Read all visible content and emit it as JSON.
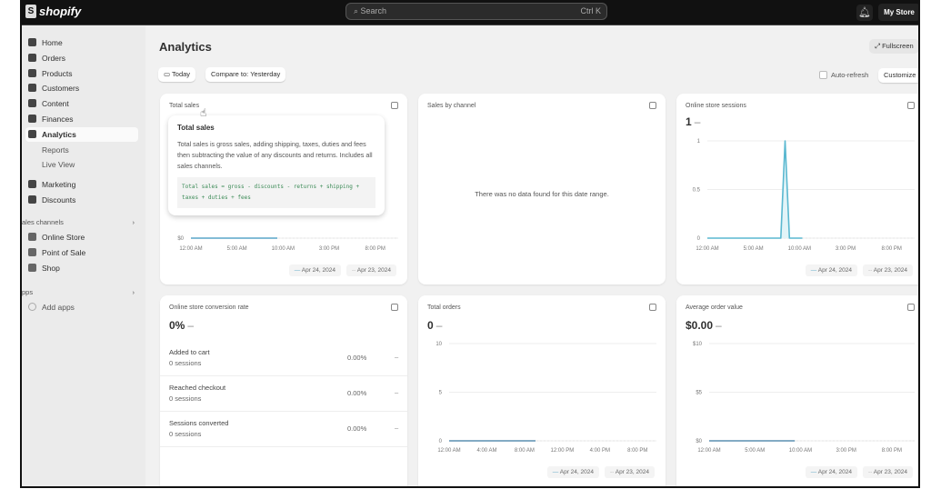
{
  "topbar": {
    "brand": "shopify",
    "search_placeholder": "Search",
    "search_shortcut": "Ctrl K",
    "store": "My Store"
  },
  "sidebar": {
    "items": [
      {
        "label": "Home"
      },
      {
        "label": "Orders"
      },
      {
        "label": "Products"
      },
      {
        "label": "Customers"
      },
      {
        "label": "Content"
      },
      {
        "label": "Finances"
      },
      {
        "label": "Analytics",
        "active": true
      },
      {
        "label": "Reports",
        "sub": true
      },
      {
        "label": "Live View",
        "sub": true
      },
      {
        "label": "Marketing"
      },
      {
        "label": "Discounts"
      }
    ],
    "sales_channels_label": "ales channels",
    "channels": [
      {
        "label": "Online Store"
      },
      {
        "label": "Point of Sale"
      },
      {
        "label": "Shop"
      }
    ],
    "apps_label": "pps",
    "add_apps": "Add apps"
  },
  "header": {
    "title": "Analytics",
    "date_button": "Today",
    "compare_button": "Compare to: Yesterday",
    "fullscreen": "Fullscreen",
    "auto_refresh": "Auto-refresh",
    "customize": "Customize"
  },
  "legend": {
    "current": "Apr 24, 2024",
    "previous": "Apr 23, 2024"
  },
  "cards": {
    "total_sales": {
      "title": "Total sales",
      "tooltip": {
        "title": "Total sales",
        "body": "Total sales is gross sales, adding shipping, taxes, duties and fees then subtracting the value of any discounts and returns. Includes all sales channels.",
        "formula": "Total sales = gross - discounts - returns + shipping + taxes + duties + fees"
      }
    },
    "sales_by_channel": {
      "title": "Sales by channel",
      "empty": "There was no data found for this date range."
    },
    "sessions": {
      "title": "Online store sessions",
      "value": "1"
    },
    "conversion": {
      "title": "Online store conversion rate",
      "value": "0%",
      "rows": [
        {
          "label": "Added to cart",
          "sub": "0 sessions",
          "pct": "0.00%",
          "change": "–"
        },
        {
          "label": "Reached checkout",
          "sub": "0 sessions",
          "pct": "0.00%",
          "change": "–"
        },
        {
          "label": "Sessions converted",
          "sub": "0 sessions",
          "pct": "0.00%",
          "change": "–"
        }
      ]
    },
    "orders": {
      "title": "Total orders",
      "value": "0"
    },
    "aov": {
      "title": "Average order value",
      "value": "$0.00"
    }
  },
  "chart_data": [
    {
      "id": "sales",
      "type": "line",
      "yticks": [
        "$0"
      ],
      "ylim": [
        0,
        1
      ],
      "xticks": [
        "12:00 AM",
        "5:00 AM",
        "10:00 AM",
        "3:00 PM",
        "8:00 PM"
      ],
      "x_hours": [
        0,
        1,
        2,
        3,
        4,
        5,
        6,
        7,
        8,
        9,
        10
      ],
      "series": [
        {
          "name": "Apr 24, 2024",
          "values": [
            0,
            0,
            0,
            0,
            0,
            0,
            0,
            0,
            0,
            0,
            0
          ]
        }
      ],
      "color": "#5aa6c8"
    },
    {
      "id": "sessions",
      "type": "line",
      "yticks": [
        "0",
        "0.5",
        "1"
      ],
      "ylim": [
        0,
        1
      ],
      "xticks": [
        "12:00 AM",
        "5:00 AM",
        "10:00 AM",
        "3:00 PM",
        "8:00 PM"
      ],
      "x_hours": [
        0,
        1,
        2,
        3,
        4,
        5,
        6,
        7,
        8,
        8.5,
        9,
        9.5,
        10,
        11
      ],
      "series": [
        {
          "name": "Apr 24, 2024",
          "values": [
            0,
            0,
            0,
            0,
            0,
            0,
            0,
            0,
            0,
            0,
            1,
            0,
            0,
            0
          ]
        }
      ],
      "color": "#5ab8d0"
    },
    {
      "id": "orders",
      "type": "line",
      "yticks": [
        "0",
        "5",
        "10"
      ],
      "ylim": [
        0,
        10
      ],
      "xticks": [
        "12:00 AM",
        "4:00 AM",
        "8:00 AM",
        "12:00 PM",
        "4:00 PM",
        "8:00 PM"
      ],
      "x_hours": [
        0,
        1,
        2,
        3,
        4,
        5,
        6,
        7,
        8,
        9,
        10
      ],
      "series": [
        {
          "name": "Apr 24, 2024",
          "values": [
            0,
            0,
            0,
            0,
            0,
            0,
            0,
            0,
            0,
            0,
            0
          ]
        }
      ],
      "color": "#5a8fb0"
    },
    {
      "id": "aov",
      "type": "line",
      "yticks": [
        "$0",
        "$5",
        "$10"
      ],
      "ylim": [
        0,
        10
      ],
      "xticks": [
        "12:00 AM",
        "5:00 AM",
        "10:00 AM",
        "3:00 PM",
        "8:00 PM"
      ],
      "x_hours": [
        0,
        1,
        2,
        3,
        4,
        5,
        6,
        7,
        8,
        9,
        10
      ],
      "series": [
        {
          "name": "Apr 24, 2024",
          "values": [
            0,
            0,
            0,
            0,
            0,
            0,
            0,
            0,
            0,
            0,
            0
          ]
        }
      ],
      "color": "#5a8fb0"
    }
  ]
}
